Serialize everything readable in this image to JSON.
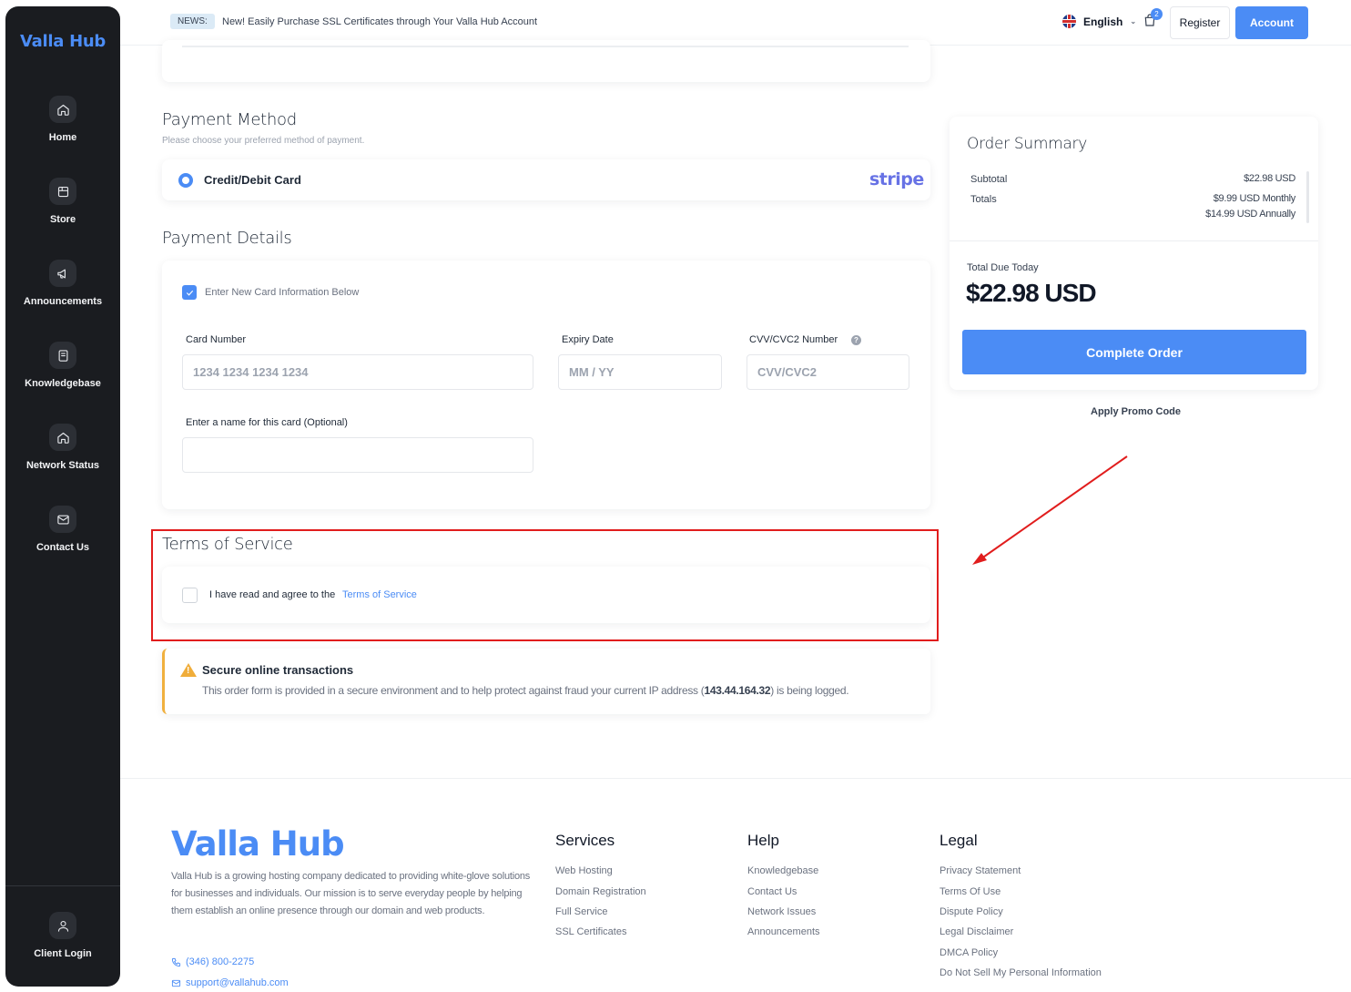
{
  "sidebar": {
    "brand": "Valla Hub",
    "items": [
      {
        "label": "Home"
      },
      {
        "label": "Store"
      },
      {
        "label": "Announcements"
      },
      {
        "label": "Knowledgebase"
      },
      {
        "label": "Network Status"
      },
      {
        "label": "Contact Us"
      }
    ],
    "client_login": "Client Login"
  },
  "topbar": {
    "news_badge": "NEWS:",
    "news_text": "New! Easily Purchase SSL Certificates through Your Valla Hub Account",
    "language": "English",
    "cart_count": "2",
    "register": "Register",
    "account": "Account"
  },
  "payment_method": {
    "title": "Payment Method",
    "subtitle": "Please choose your preferred method of payment.",
    "option_label": "Credit/Debit Card",
    "provider": "stripe"
  },
  "payment_details": {
    "title": "Payment Details",
    "new_card_label": "Enter New Card Information Below",
    "card_number_label": "Card Number",
    "card_number_placeholder": "1234 1234 1234 1234",
    "expiry_label": "Expiry Date",
    "expiry_placeholder": "MM / YY",
    "cvv_label": "CVV/CVC2 Number",
    "cvv_placeholder": "CVV/CVC2",
    "card_name_label": "Enter a name for this card (Optional)"
  },
  "terms": {
    "title": "Terms of Service",
    "agree_text": "I have read and agree to the",
    "link_text": "Terms of Service"
  },
  "secure": {
    "title": "Secure online transactions",
    "text_before": "This order form is provided in a secure environment and to help protect against fraud your current IP address (",
    "ip": "143.44.164.32",
    "text_after": ") is being logged."
  },
  "order_summary": {
    "title": "Order Summary",
    "subtotal_label": "Subtotal",
    "subtotal_value": "$22.98 USD",
    "totals_label": "Totals",
    "totals_monthly": "$9.99 USD Monthly",
    "totals_annually": "$14.99 USD Annually",
    "due_label": "Total Due Today",
    "due_value": "$22.98 USD",
    "complete_button": "Complete Order",
    "promo_link": "Apply Promo Code"
  },
  "footer": {
    "brand": "Valla Hub",
    "description": "Valla Hub is a growing hosting company dedicated to providing white-glove solutions for businesses and individuals. Our mission is to serve everyday people by helping them establish an online presence through our domain and web products.",
    "phone": "(346) 800-2275",
    "email": "support@vallahub.com",
    "columns": [
      {
        "title": "Services",
        "links": [
          "Web Hosting",
          "Domain Registration",
          "Full Service",
          "SSL Certificates"
        ]
      },
      {
        "title": "Help",
        "links": [
          "Knowledgebase",
          "Contact Us",
          "Network Issues",
          "Announcements"
        ]
      },
      {
        "title": "Legal",
        "links": [
          "Privacy Statement",
          "Terms Of Use",
          "Dispute Policy",
          "Legal Disclaimer",
          "DMCA Policy",
          "Do Not Sell My Personal Information"
        ]
      }
    ]
  },
  "colors": {
    "accent": "#4b8cf5",
    "sidebar_bg": "#1a1c20",
    "highlight_red": "#e11d1d",
    "warning": "#f0ad3a"
  }
}
